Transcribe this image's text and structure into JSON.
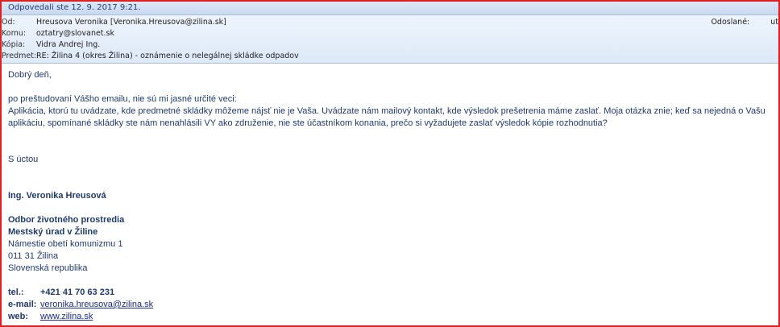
{
  "info_bar": {
    "text": "Odpovedali ste 12. 9. 2017 9:21."
  },
  "headers": {
    "from_label": "Od:",
    "from_value": "Hreusova Veronika [Veronika.Hreusova@zilina.sk]",
    "to_label": "Komu:",
    "to_value": "oztatry@slovanet.sk",
    "cc_label": "Kópia:",
    "cc_value": "Vidra Andrej Ing.",
    "subject_label": "Predmet:",
    "subject_value": "RE: Žilina 4 (okres Žilina) - oznámenie o nelegálnej skládke odpadov",
    "sent_label": "Odoslané:",
    "sent_value": "ut"
  },
  "body": {
    "greeting": "Dobrý deň,",
    "intro": "po preštudovaní Vášho emailu, nie sú mi jasné určité veci:",
    "para_line1": "Aplikácia, ktorú tu uvádzate, kde predmetné skládky môžeme nájsť nie je Vaša.  Uvádzate nám mailový kontakt, kde výsledok prešetrenia máme zaslať.  Moja otázka znie; keď sa nejedná o Vašu",
    "para_line2": "aplikáciu, spomínané skládky ste nám nenahlásili VY ako združenie, nie ste účastníkom konania, prečo si vyžadujete zaslať výsledok kópie rozhodnutia?",
    "closing": "S úctou"
  },
  "signature": {
    "name": "Ing. Veronika Hreusová",
    "dept": "Odbor životného prostredia",
    "office": "Mestský úrad v Žiline",
    "street": "Námestie obetí komunizmu 1",
    "city": "011 31 Žilina",
    "country": "Slovenská republika",
    "tel_label": "tel.:",
    "tel_value": "+421 41 70 63 231",
    "email_label": "e-mail:",
    "email_value": "veronika.hreusova@zilina.sk",
    "web_label": "web:",
    "web_value": "www.zilina.sk"
  },
  "colors": {
    "frame": "#e02020",
    "header_bg": "#dde9f8",
    "body_text": "#1f3a6d",
    "link": "#1a2b88"
  }
}
